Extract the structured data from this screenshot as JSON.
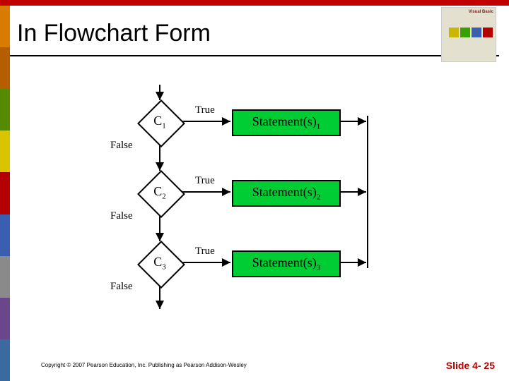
{
  "slide": {
    "title": "In Flowchart Form",
    "copyright": "Copyright © 2007 Pearson Education, Inc. Publishing as Pearson Addison-Wesley",
    "slide_label": "Slide 4- 25",
    "logo_brand": "Visual Basic"
  },
  "flow": {
    "true_label": "True",
    "false_label": "False",
    "nodes": [
      {
        "cond_base": "C",
        "cond_sub": "1",
        "stmt_base": "Statement(s)",
        "stmt_sub": "1"
      },
      {
        "cond_base": "C",
        "cond_sub": "2",
        "stmt_base": "Statement(s)",
        "stmt_sub": "2"
      },
      {
        "cond_base": "C",
        "cond_sub": "3",
        "stmt_base": "Statement(s)",
        "stmt_sub": "3"
      }
    ]
  },
  "spine_colors": [
    "#d97b00",
    "#b55e00",
    "#568a00",
    "#d9c400",
    "#b50000",
    "#3a5fb0",
    "#8a8a8a",
    "#6a478a",
    "#3a6aa0"
  ],
  "logo_blocks": [
    "#c9b800",
    "#3aa000",
    "#3a5fb0",
    "#b50000"
  ]
}
